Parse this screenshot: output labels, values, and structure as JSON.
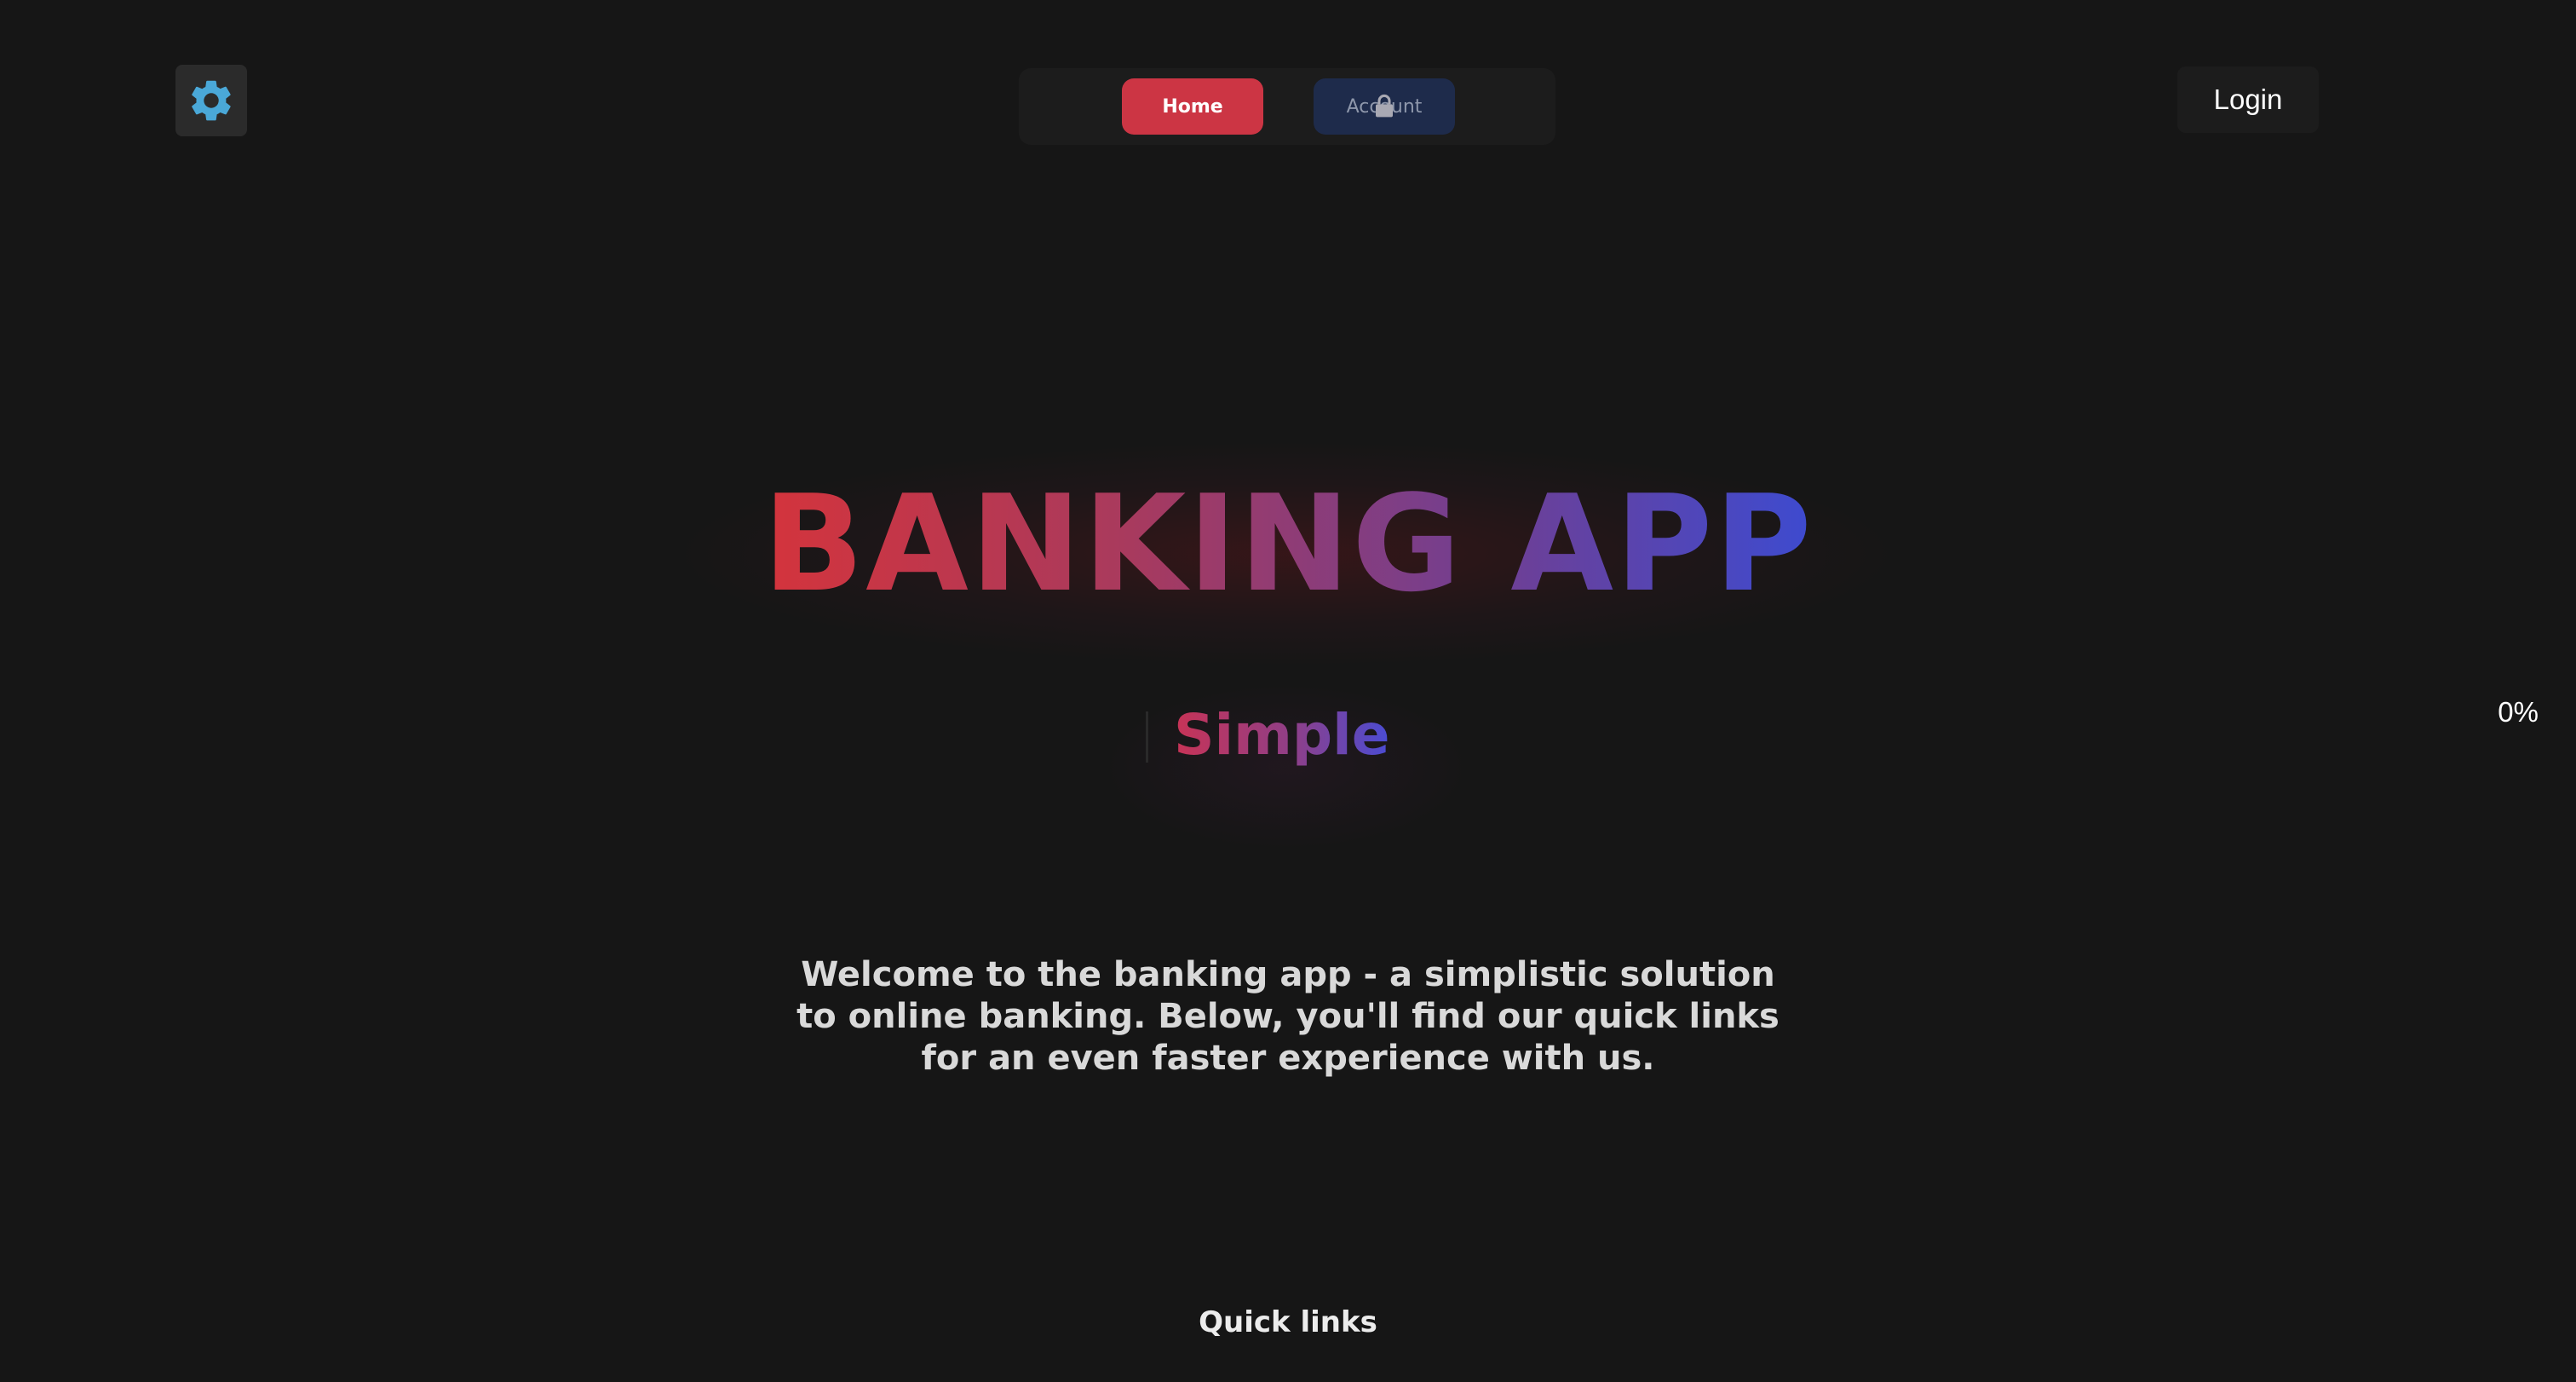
{
  "header": {
    "settings_icon": "gear-icon",
    "settings_icon_color": "#4aa8d8",
    "nav": {
      "home_label": "Home",
      "account_label": "Account",
      "account_locked_icon": "lock-icon",
      "home_color": "#cc3544",
      "account_color": "#1e2b4b"
    },
    "login_label": "Login"
  },
  "hero": {
    "title": "BANKING APP",
    "subtitle": "Simple",
    "gradient_colors": [
      "#d4343c",
      "#a83a5e",
      "#6f3f94",
      "#3d4bd0"
    ]
  },
  "progress_label": "0%",
  "intro_text": "Welcome to the banking app - a simplistic solution to online banking. Below, you'll find our quick links for an even faster experience with us.",
  "quick_links": {
    "heading": "Quick links"
  }
}
